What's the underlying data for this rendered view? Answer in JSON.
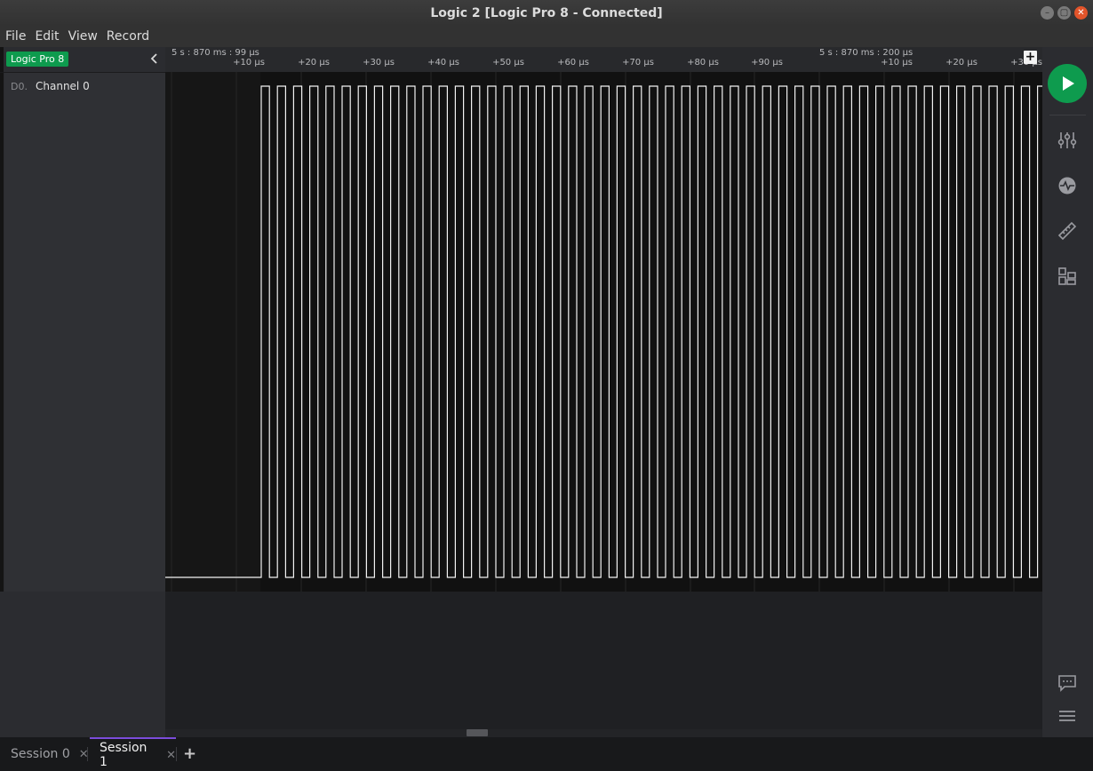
{
  "window": {
    "title": "Logic 2 [Logic Pro 8 - Connected]"
  },
  "menu": [
    "File",
    "Edit",
    "View",
    "Record"
  ],
  "device": {
    "name": "Logic Pro 8",
    "badge_color": "#0e9b4e"
  },
  "channels": [
    {
      "id": "D0.",
      "name": "Channel 0"
    }
  ],
  "ruler": {
    "absolute_labels": [
      "5 s : 870 ms : 99 µs",
      "5 s : 870 ms : 200 µs"
    ],
    "ticks": [
      "+10 µs",
      "+20 µs",
      "+30 µs",
      "+40 µs",
      "+50 µs",
      "+60 µs",
      "+70 µs",
      "+80 µs",
      "+90 µs",
      "+10 µs",
      "+20 µs",
      "+30 µs"
    ]
  },
  "tabs": [
    {
      "label": "Session 0",
      "active": false
    },
    {
      "label": "Session 1",
      "active": true
    }
  ],
  "icons": {
    "collapse": "chevron-left-icon",
    "play": "play-icon",
    "settings": "sliders-icon",
    "analyzers": "waveform-analyzer-icon",
    "measure": "ruler-icon",
    "extensions": "extensions-icon",
    "feedback": "chat-icon",
    "menu": "hamburger-menu-icon",
    "add": "plus-icon"
  },
  "colors": {
    "accent": "#0e9b4e",
    "active_tab": "#7b4cdb",
    "signal": "#f2f2f2"
  }
}
